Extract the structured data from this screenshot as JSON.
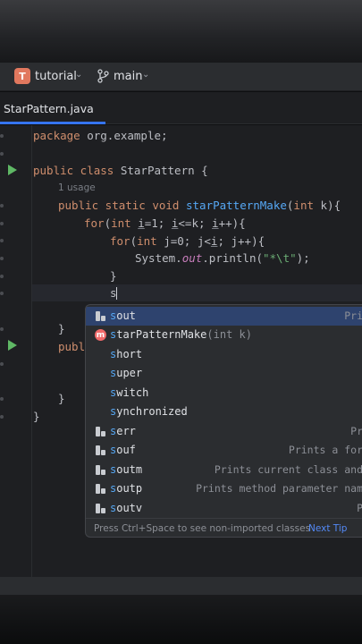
{
  "project": {
    "badge": "T",
    "name": "tutorial"
  },
  "branch": {
    "name": "main",
    "icon": "git-branch-icon"
  },
  "tab": {
    "label": "StarPattern.java"
  },
  "code": {
    "package_kw": "package",
    "package_name": " org.example;",
    "class_kw": "public class",
    "class_name": " StarPattern {",
    "usage_hint": "1 usage",
    "method_kw": "public static void",
    "method_name": "starPatternMake",
    "method_params_open": "(",
    "method_params_kw": "int",
    "method_params_rest": " k){",
    "for1_kw": "for",
    "for1_a": "(",
    "for1_int": "int",
    "for1_b": " ",
    "for1_i": "i",
    "for1_c": "=1; ",
    "for1_i2": "i",
    "for1_d": "<=k; ",
    "for1_i3": "i",
    "for1_e": "++){",
    "for2_kw": "for",
    "for2_a": "(",
    "for2_int": "int",
    "for2_b": " j=0; j<",
    "for2_i": "i",
    "for2_c": "; j++){",
    "println_a": "System.",
    "println_out": "out",
    "println_b": ".println(",
    "println_str": "\"*\\t\"",
    "println_c": ");",
    "close_inner": "}",
    "typed": "s",
    "close_method": "}",
    "second_method_kw": "publ",
    "close_method2": "}",
    "close_class": "}"
  },
  "completion": {
    "items": [
      {
        "icon": "live-template-icon",
        "prefix": "s",
        "rest": "out",
        "desc": "Pri"
      },
      {
        "icon": "method-icon",
        "prefix": "s",
        "rest": "tarPatternMake",
        "sig": "(int k)",
        "desc": ""
      },
      {
        "icon": "",
        "prefix": "s",
        "rest": "hort",
        "desc": ""
      },
      {
        "icon": "",
        "prefix": "s",
        "rest": "uper",
        "desc": ""
      },
      {
        "icon": "",
        "prefix": "s",
        "rest": "witch",
        "desc": ""
      },
      {
        "icon": "",
        "prefix": "s",
        "rest": "ynchronized",
        "desc": ""
      },
      {
        "icon": "live-template-icon",
        "prefix": "s",
        "rest": "err",
        "desc": "Pr"
      },
      {
        "icon": "live-template-icon",
        "prefix": "s",
        "rest": "ouf",
        "desc": "Prints a for"
      },
      {
        "icon": "live-template-icon",
        "prefix": "s",
        "rest": "outm",
        "desc": "Prints current class and"
      },
      {
        "icon": "live-template-icon",
        "prefix": "s",
        "rest": "outp",
        "desc": "Prints method parameter nam"
      },
      {
        "icon": "live-template-icon",
        "prefix": "s",
        "rest": "outv",
        "desc": "P"
      }
    ],
    "footer_text": "Press Ctrl+Space to see non-imported classes",
    "footer_link": "Next Tip"
  },
  "colors": {
    "accent": "#3574f0",
    "keyword": "#cf8e6d",
    "function": "#56a8f5",
    "string": "#6aab73",
    "run": "#5fb865"
  }
}
